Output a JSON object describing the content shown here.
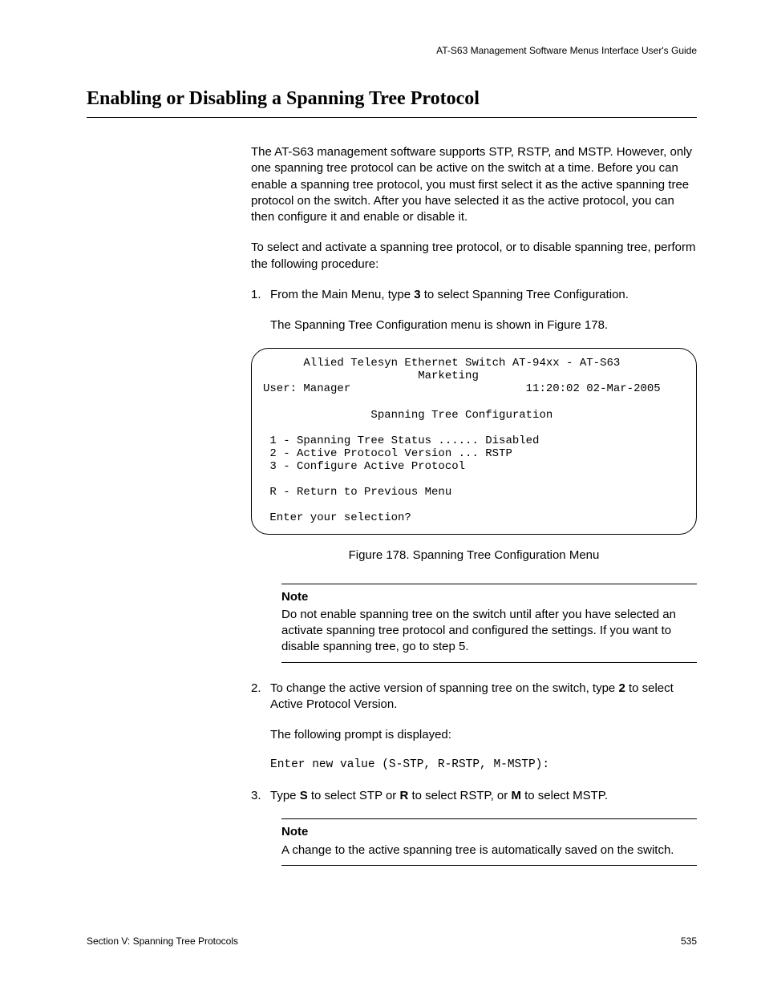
{
  "header": {
    "guide": "AT-S63 Management Software Menus Interface User's Guide"
  },
  "title": "Enabling or Disabling a Spanning Tree Protocol",
  "p1": "The AT-S63 management software supports STP, RSTP, and MSTP. However, only one spanning tree protocol can be active on the switch at a time. Before you can enable a spanning tree protocol, you must first select it as the active spanning tree protocol on the switch. After you have selected it as the active protocol, you can then configure it and enable or disable it.",
  "p2": "To select and activate a spanning tree protocol, or to disable spanning tree, perform the following procedure:",
  "step1_num": "1.",
  "step1_a": "From the Main Menu, type ",
  "step1_b": "3",
  "step1_c": " to select Spanning Tree Configuration.",
  "step1_sub": "The Spanning Tree Configuration menu is shown in Figure 178.",
  "terminal": {
    "l1": "      Allied Telesyn Ethernet Switch AT-94xx - AT-S63",
    "l2": "                       Marketing",
    "l3": "User: Manager                          11:20:02 02-Mar-2005",
    "l4": "                Spanning Tree Configuration",
    "l5": " 1 - Spanning Tree Status ...... Disabled",
    "l6": " 2 - Active Protocol Version ... RSTP",
    "l7": " 3 - Configure Active Protocol",
    "l8": " R - Return to Previous Menu",
    "l9": " Enter your selection?"
  },
  "figure_caption": "Figure 178. Spanning Tree Configuration Menu",
  "note1": {
    "title": "Note",
    "body": "Do not enable spanning tree on the switch until after you have selected an activate spanning tree protocol and configured the settings. If you want to disable spanning tree, go to step 5."
  },
  "step2_num": "2.",
  "step2_a": "To change the active version of spanning tree on the switch, type ",
  "step2_b": "2",
  "step2_c": " to select Active Protocol Version.",
  "step2_sub": "The following prompt is displayed:",
  "prompt": "Enter new value (S-STP, R-RSTP, M-MSTP):",
  "step3_num": "3.",
  "step3_a": "Type ",
  "step3_b": "S",
  "step3_c": " to select STP or ",
  "step3_d": "R",
  "step3_e": " to select RSTP, or ",
  "step3_f": "M",
  "step3_g": " to select MSTP.",
  "note2": {
    "title": "Note",
    "body": "A change to the active spanning tree is automatically saved on the switch."
  },
  "footer": {
    "section": "Section V: Spanning Tree Protocols",
    "page": "535"
  }
}
